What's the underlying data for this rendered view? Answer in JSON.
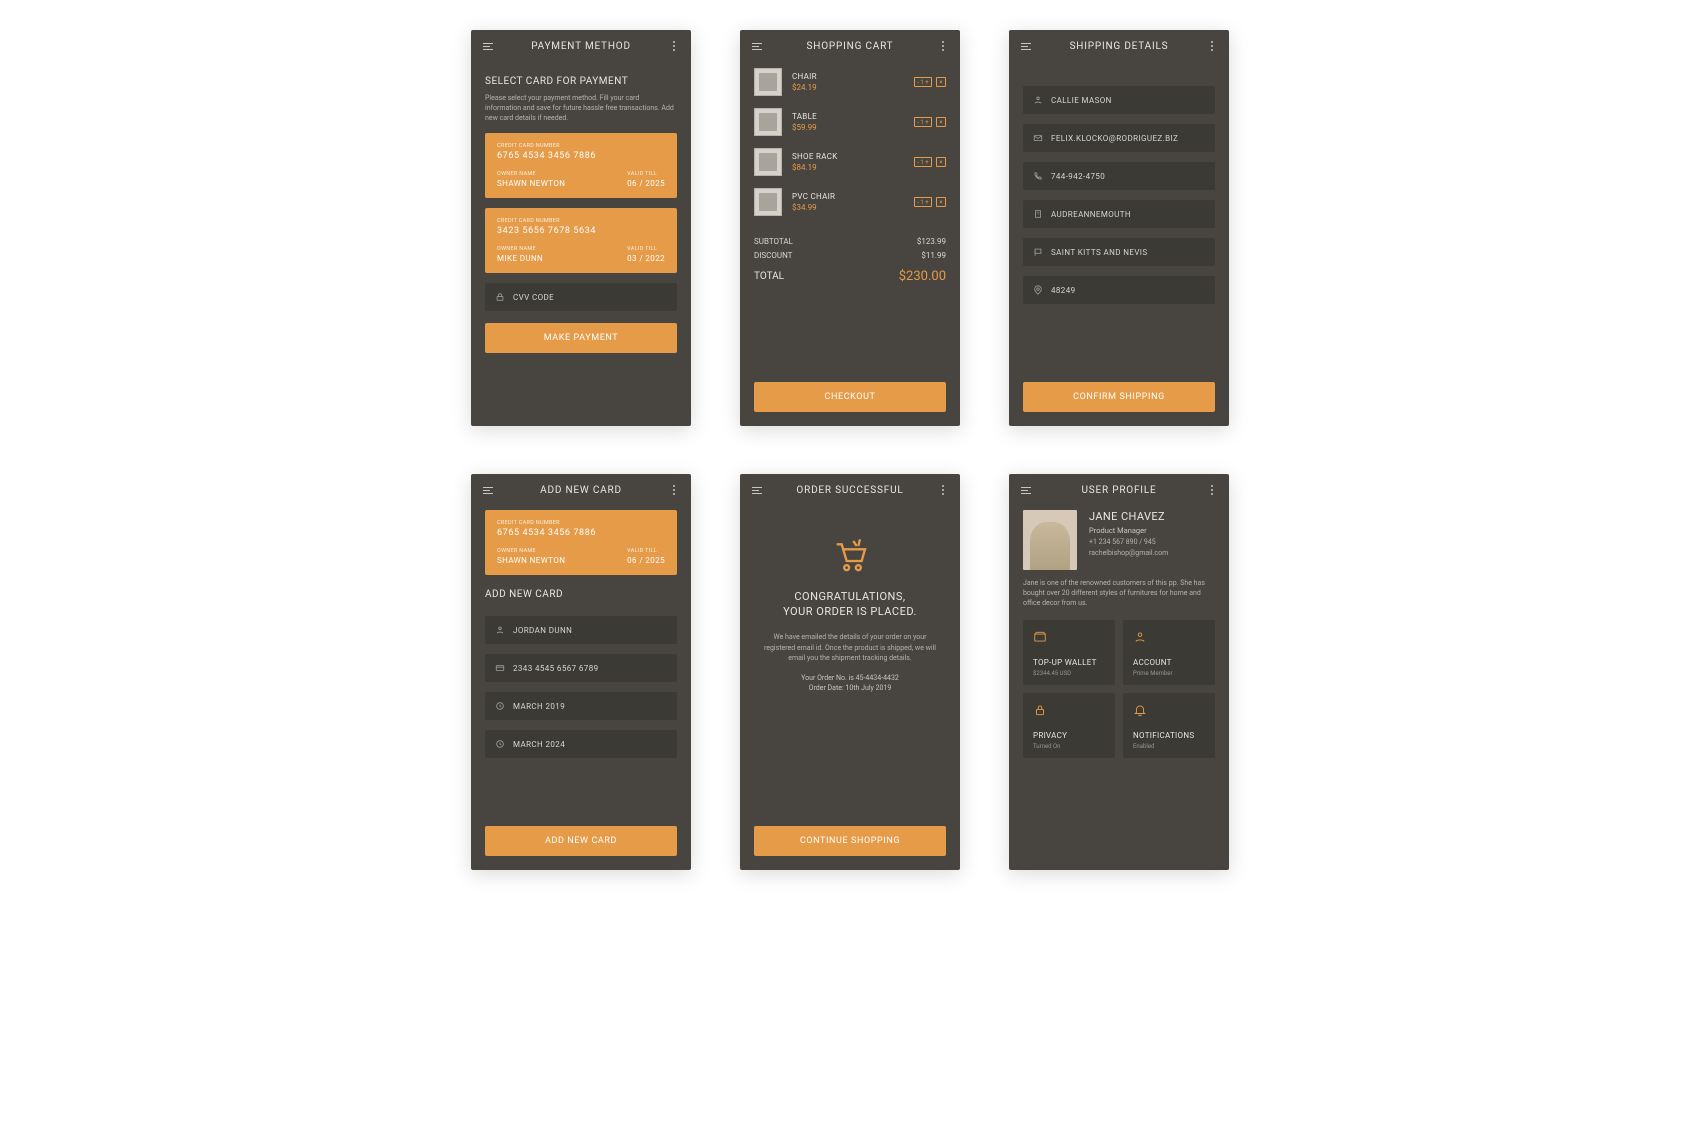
{
  "screens": {
    "payment": {
      "title": "PAYMENT METHOD",
      "heading": "SELECT CARD FOR PAYMENT",
      "body": "Please select your payment method. Fill your card information and save for future hassle free transactions. Add new card details if needed.",
      "cards": [
        {
          "num_lab": "CREDIT CARD NUMBER",
          "number": "6765 4534 3456 7886",
          "owner_lab": "OWNER NAME",
          "owner": "SHAWN NEWTON",
          "valid_lab": "VALID TILL",
          "valid": "06 / 2025"
        },
        {
          "num_lab": "CREDIT CARD NUMBER",
          "number": "3423 5656 7678 5634",
          "owner_lab": "OWNER NAME",
          "owner": "MIKE DUNN",
          "valid_lab": "VALID TILL",
          "valid": "03 / 2022"
        }
      ],
      "cvv_label": "CVV CODE",
      "button": "MAKE PAYMENT"
    },
    "cart": {
      "title": "SHOPPING CART",
      "items": [
        {
          "name": "CHAIR",
          "price": "$24.19",
          "qty": "1"
        },
        {
          "name": "TABLE",
          "price": "$59.99",
          "qty": "1"
        },
        {
          "name": "SHOE RACK",
          "price": "$84.19",
          "qty": "1"
        },
        {
          "name": "PVC CHAIR",
          "price": "$34.99",
          "qty": "1"
        }
      ],
      "subtotal_lab": "SUBTOTAL",
      "subtotal": "$123.99",
      "discount_lab": "DISCOUNT",
      "discount": "$11.99",
      "total_lab": "TOTAL",
      "total": "$230.00",
      "button": "CHECKOUT"
    },
    "shipping": {
      "title": "SHIPPING DETAILS",
      "fields": [
        "CALLIE MASON",
        "FELIX.KLOCKO@RODRIGUEZ.BIZ",
        "744-942-4750",
        "AUDREANNEMOUTH",
        "SAINT KITTS AND NEVIS",
        "48249"
      ],
      "button": "CONFIRM SHIPPING"
    },
    "addcard": {
      "title": "ADD NEW CARD",
      "card": {
        "num_lab": "CREDIT CARD NUMBER",
        "number": "6765 4534 3456 7886",
        "owner_lab": "OWNER NAME",
        "owner": "SHAWN NEWTON",
        "valid_lab": "VALID TILL",
        "valid": "06 / 2025"
      },
      "heading": "ADD NEW CARD",
      "fields": [
        "JORDAN DUNN",
        "2343 4545 6567 6789",
        "MARCH 2019",
        "MARCH 2024"
      ],
      "button": "ADD NEW CARD"
    },
    "success": {
      "title": "ORDER SUCCESSFUL",
      "line1": "CONGRATULATIONS,",
      "line2": "YOUR ORDER IS PLACED.",
      "desc": "We have emailed the details of your order on your registered email id. Once the product is shipped, we will email you the shipment tracking details.",
      "order_line": "Your Order No. is 45-4434-4432",
      "date_line": "Order Date: 10th July 2019",
      "button": "CONTINUE SHOPPING"
    },
    "profile": {
      "title": "USER PROFILE",
      "name": "JANE CHAVEZ",
      "role": "Product Manager",
      "phone": "+1 234 567 890 / 945",
      "email": "rachelbishop@gmail.com",
      "bio": "Jane is one of the renowned customers of this pp. She has bought over 20 different styles of furnitures for home and office decor from us.",
      "tiles": [
        {
          "t": "TOP-UP WALLET",
          "s": "$2344.45 USD"
        },
        {
          "t": "ACCOUNT",
          "s": "Prime Member"
        },
        {
          "t": "PRIVACY",
          "s": "Turned On"
        },
        {
          "t": "NOTIFICATIONS",
          "s": "Enabled"
        }
      ]
    }
  }
}
